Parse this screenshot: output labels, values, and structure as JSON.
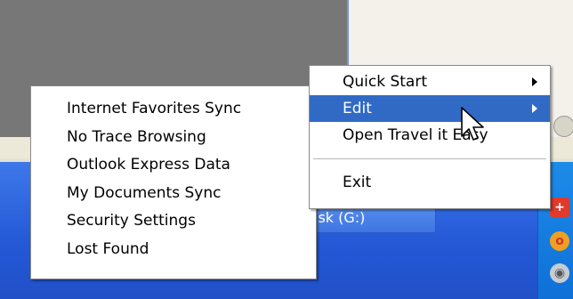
{
  "main_menu": {
    "items": [
      {
        "label": "Quick Start",
        "has_submenu": true
      },
      {
        "label": "Edit",
        "has_submenu": true,
        "highlighted": true
      },
      {
        "label": "Open Travel it Easy",
        "has_submenu": false
      },
      {
        "label": "Exit",
        "has_submenu": false
      }
    ]
  },
  "submenu": {
    "items": [
      {
        "label": "Internet Favorites Sync"
      },
      {
        "label": "No Trace Browsing"
      },
      {
        "label": "Outlook Express Data"
      },
      {
        "label": "My Documents Sync"
      },
      {
        "label": "Security Settings"
      },
      {
        "label": "Lost  Found"
      }
    ]
  },
  "taskbar": {
    "button_label": "isk (G:)"
  },
  "tray": {
    "icons": [
      "red-plus-icon",
      "orange-ring-icon",
      "grey-disc-icon"
    ]
  },
  "colors": {
    "highlight": "#316ac5",
    "taskbar": "#2458d6",
    "menu_bg": "#ffffff"
  }
}
